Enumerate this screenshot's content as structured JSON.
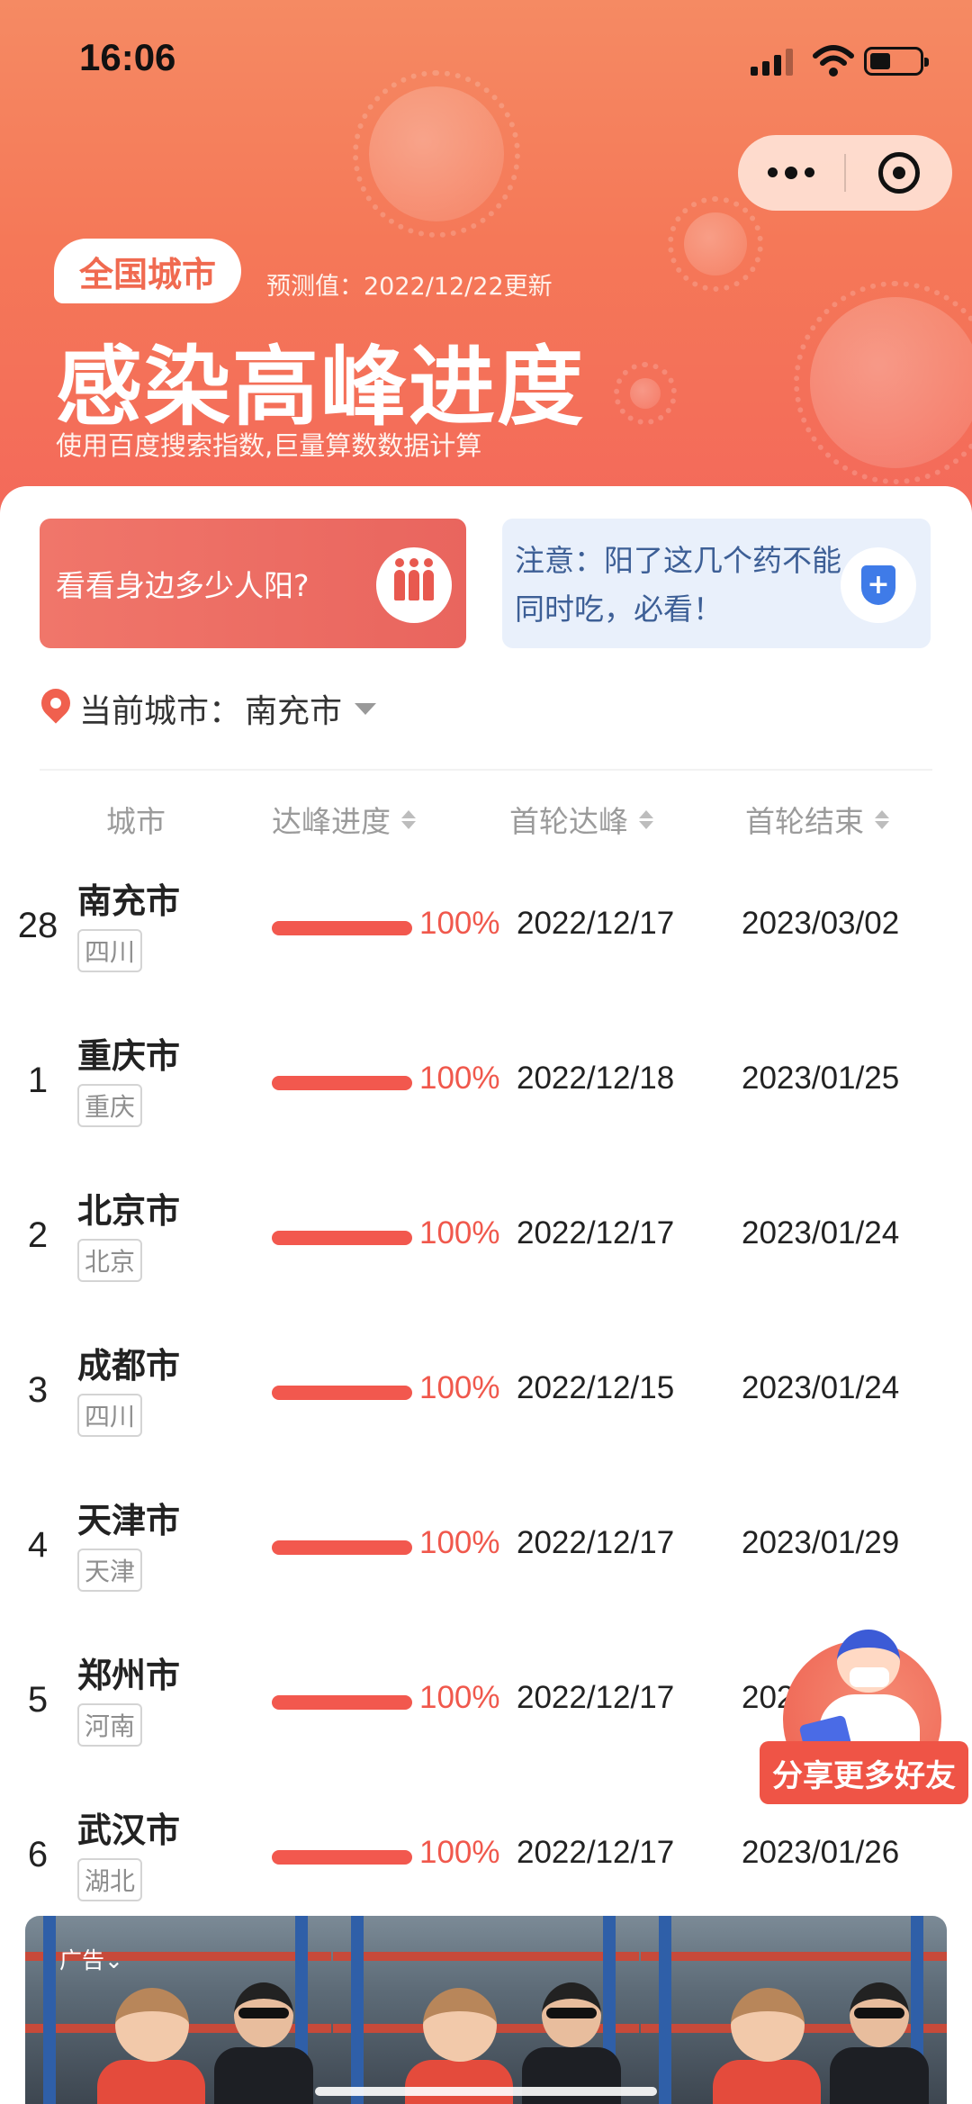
{
  "status_bar": {
    "time": "16:06"
  },
  "header": {
    "scope_tab": "全国城市",
    "predict_text": "预测值：2022/12/22更新",
    "title": "感染高峰进度",
    "subtitle": "使用百度搜索指数,巨量算数数据计算"
  },
  "banners": {
    "left": {
      "text": "看看身边多少人阳?",
      "icon": "people-icon"
    },
    "right": {
      "text": "注意：阳了这几个药不能同时吃，必看！",
      "icon": "shield-plus-icon"
    }
  },
  "city_selector": {
    "label": "当前城市：",
    "value": "南充市"
  },
  "table": {
    "headers": [
      "城市",
      "达峰进度",
      "首轮达峰",
      "首轮结束"
    ],
    "rows": [
      {
        "rank": "28",
        "city": "南充市",
        "province": "四川",
        "progress": "100%",
        "peak": "2022/12/17",
        "end": "2023/03/02"
      },
      {
        "rank": "1",
        "city": "重庆市",
        "province": "重庆",
        "progress": "100%",
        "peak": "2022/12/18",
        "end": "2023/01/25"
      },
      {
        "rank": "2",
        "city": "北京市",
        "province": "北京",
        "progress": "100%",
        "peak": "2022/12/17",
        "end": "2023/01/24"
      },
      {
        "rank": "3",
        "city": "成都市",
        "province": "四川",
        "progress": "100%",
        "peak": "2022/12/15",
        "end": "2023/01/24"
      },
      {
        "rank": "4",
        "city": "天津市",
        "province": "天津",
        "progress": "100%",
        "peak": "2022/12/17",
        "end": "2023/01/29"
      },
      {
        "rank": "5",
        "city": "郑州市",
        "province": "河南",
        "progress": "100%",
        "peak": "2022/12/17",
        "end": "202"
      },
      {
        "rank": "6",
        "city": "武汉市",
        "province": "湖北",
        "progress": "100%",
        "peak": "2022/12/17",
        "end": "2023/01/26"
      }
    ]
  },
  "share": {
    "label": "分享更多好友"
  },
  "ad": {
    "label": "广告⌄"
  },
  "colors": {
    "accent": "#f2584e",
    "header_bg": "#f57858",
    "link_blue": "#3d5f96"
  }
}
